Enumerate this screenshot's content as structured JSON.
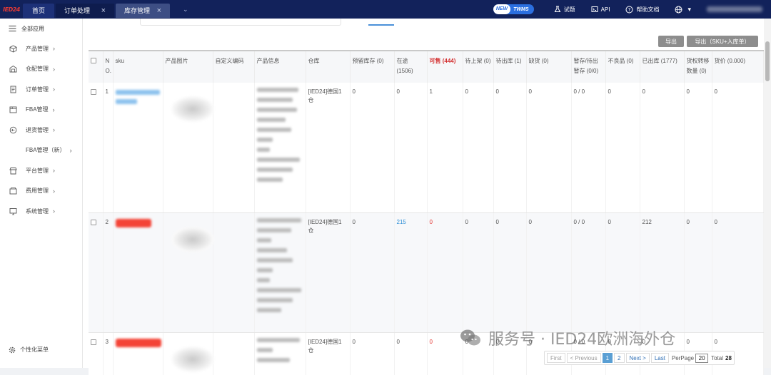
{
  "topbar": {
    "logo_text": "IED24",
    "tabs": [
      {
        "label": "首页"
      },
      {
        "label": "订单处理",
        "close": "×"
      },
      {
        "label": "库存管理",
        "close": "×"
      }
    ],
    "more": "⌄",
    "badge_new": "NEW",
    "badge_twms": "TWMS",
    "trial": "试题",
    "api": "API",
    "help": "帮助文档",
    "lang_caret": "▾"
  },
  "sidebar": {
    "all_apps": "全部应用",
    "items": [
      {
        "label": "产品管理",
        "icon": "cube-icon"
      },
      {
        "label": "仓配管理",
        "icon": "warehouse-icon"
      },
      {
        "label": "订单管理",
        "icon": "document-icon"
      },
      {
        "label": "FBA管理",
        "icon": "box-icon"
      },
      {
        "label": "退货管理",
        "icon": "return-icon"
      },
      {
        "label": "FBA管理（新）",
        "icon": ""
      },
      {
        "label": "平台管理",
        "icon": "shop-icon"
      },
      {
        "label": "费用管理",
        "icon": "wallet-icon"
      },
      {
        "label": "系统管理",
        "icon": "monitor-icon"
      }
    ],
    "chevron": "›",
    "custom_menu": "个性化菜单"
  },
  "actions": {
    "export": "导出",
    "export_sku": "导出（SKU+入库单）"
  },
  "table": {
    "headers": {
      "no": "N O.",
      "sku": "sku",
      "image": "产品图片",
      "custom_code": "自定义编码",
      "info": "产品信息",
      "warehouse": "仓库",
      "reserved": "预留库存 (0)",
      "in_transit": "在途 (1506)",
      "sellable": "可售 (444)",
      "to_shelf": "待上架 (0)",
      "to_ship": "待出库 (1)",
      "shortage": "缺货 (0)",
      "staged": "暂存/待出暂存 (0/0)",
      "defective": "不良品 (0)",
      "shipped": "已出库 (1777)",
      "transfer": "货权转移数量 (0)",
      "value": "货价 (0.000)"
    },
    "rows": [
      {
        "no": "1",
        "warehouse": "[IED24]德国1仓",
        "reserved": "0",
        "in_transit": "0",
        "sellable": "1",
        "to_shelf": "0",
        "to_ship": "0",
        "shortage": "0",
        "staged": "0 / 0",
        "defective": "0",
        "shipped": "0",
        "transfer": "0",
        "value": "0"
      },
      {
        "no": "2",
        "warehouse": "[IED24]德国1仓",
        "reserved": "0",
        "in_transit": "215",
        "sellable": "0",
        "to_shelf": "0",
        "to_ship": "0",
        "shortage": "0",
        "staged": "0 / 0",
        "defective": "0",
        "shipped": "212",
        "transfer": "0",
        "value": "0"
      },
      {
        "no": "3",
        "warehouse": "[IED24]德国1仓",
        "reserved": "0",
        "in_transit": "0",
        "sellable": "0",
        "to_shelf": "0",
        "to_ship": "0",
        "shortage": "0",
        "staged": "0 / 0",
        "defective": "0",
        "shipped": "0",
        "transfer": "0",
        "value": "0"
      }
    ]
  },
  "pager": {
    "first": "First",
    "previous": "< Previous",
    "pages": [
      "1",
      "2"
    ],
    "next": "Next >",
    "last": "Last",
    "per_page_label": "PerPage",
    "per_page_value": "20",
    "total_label": "Total",
    "total_value": "28"
  },
  "watermark": "服务号 · IED24欧洲海外仓"
}
